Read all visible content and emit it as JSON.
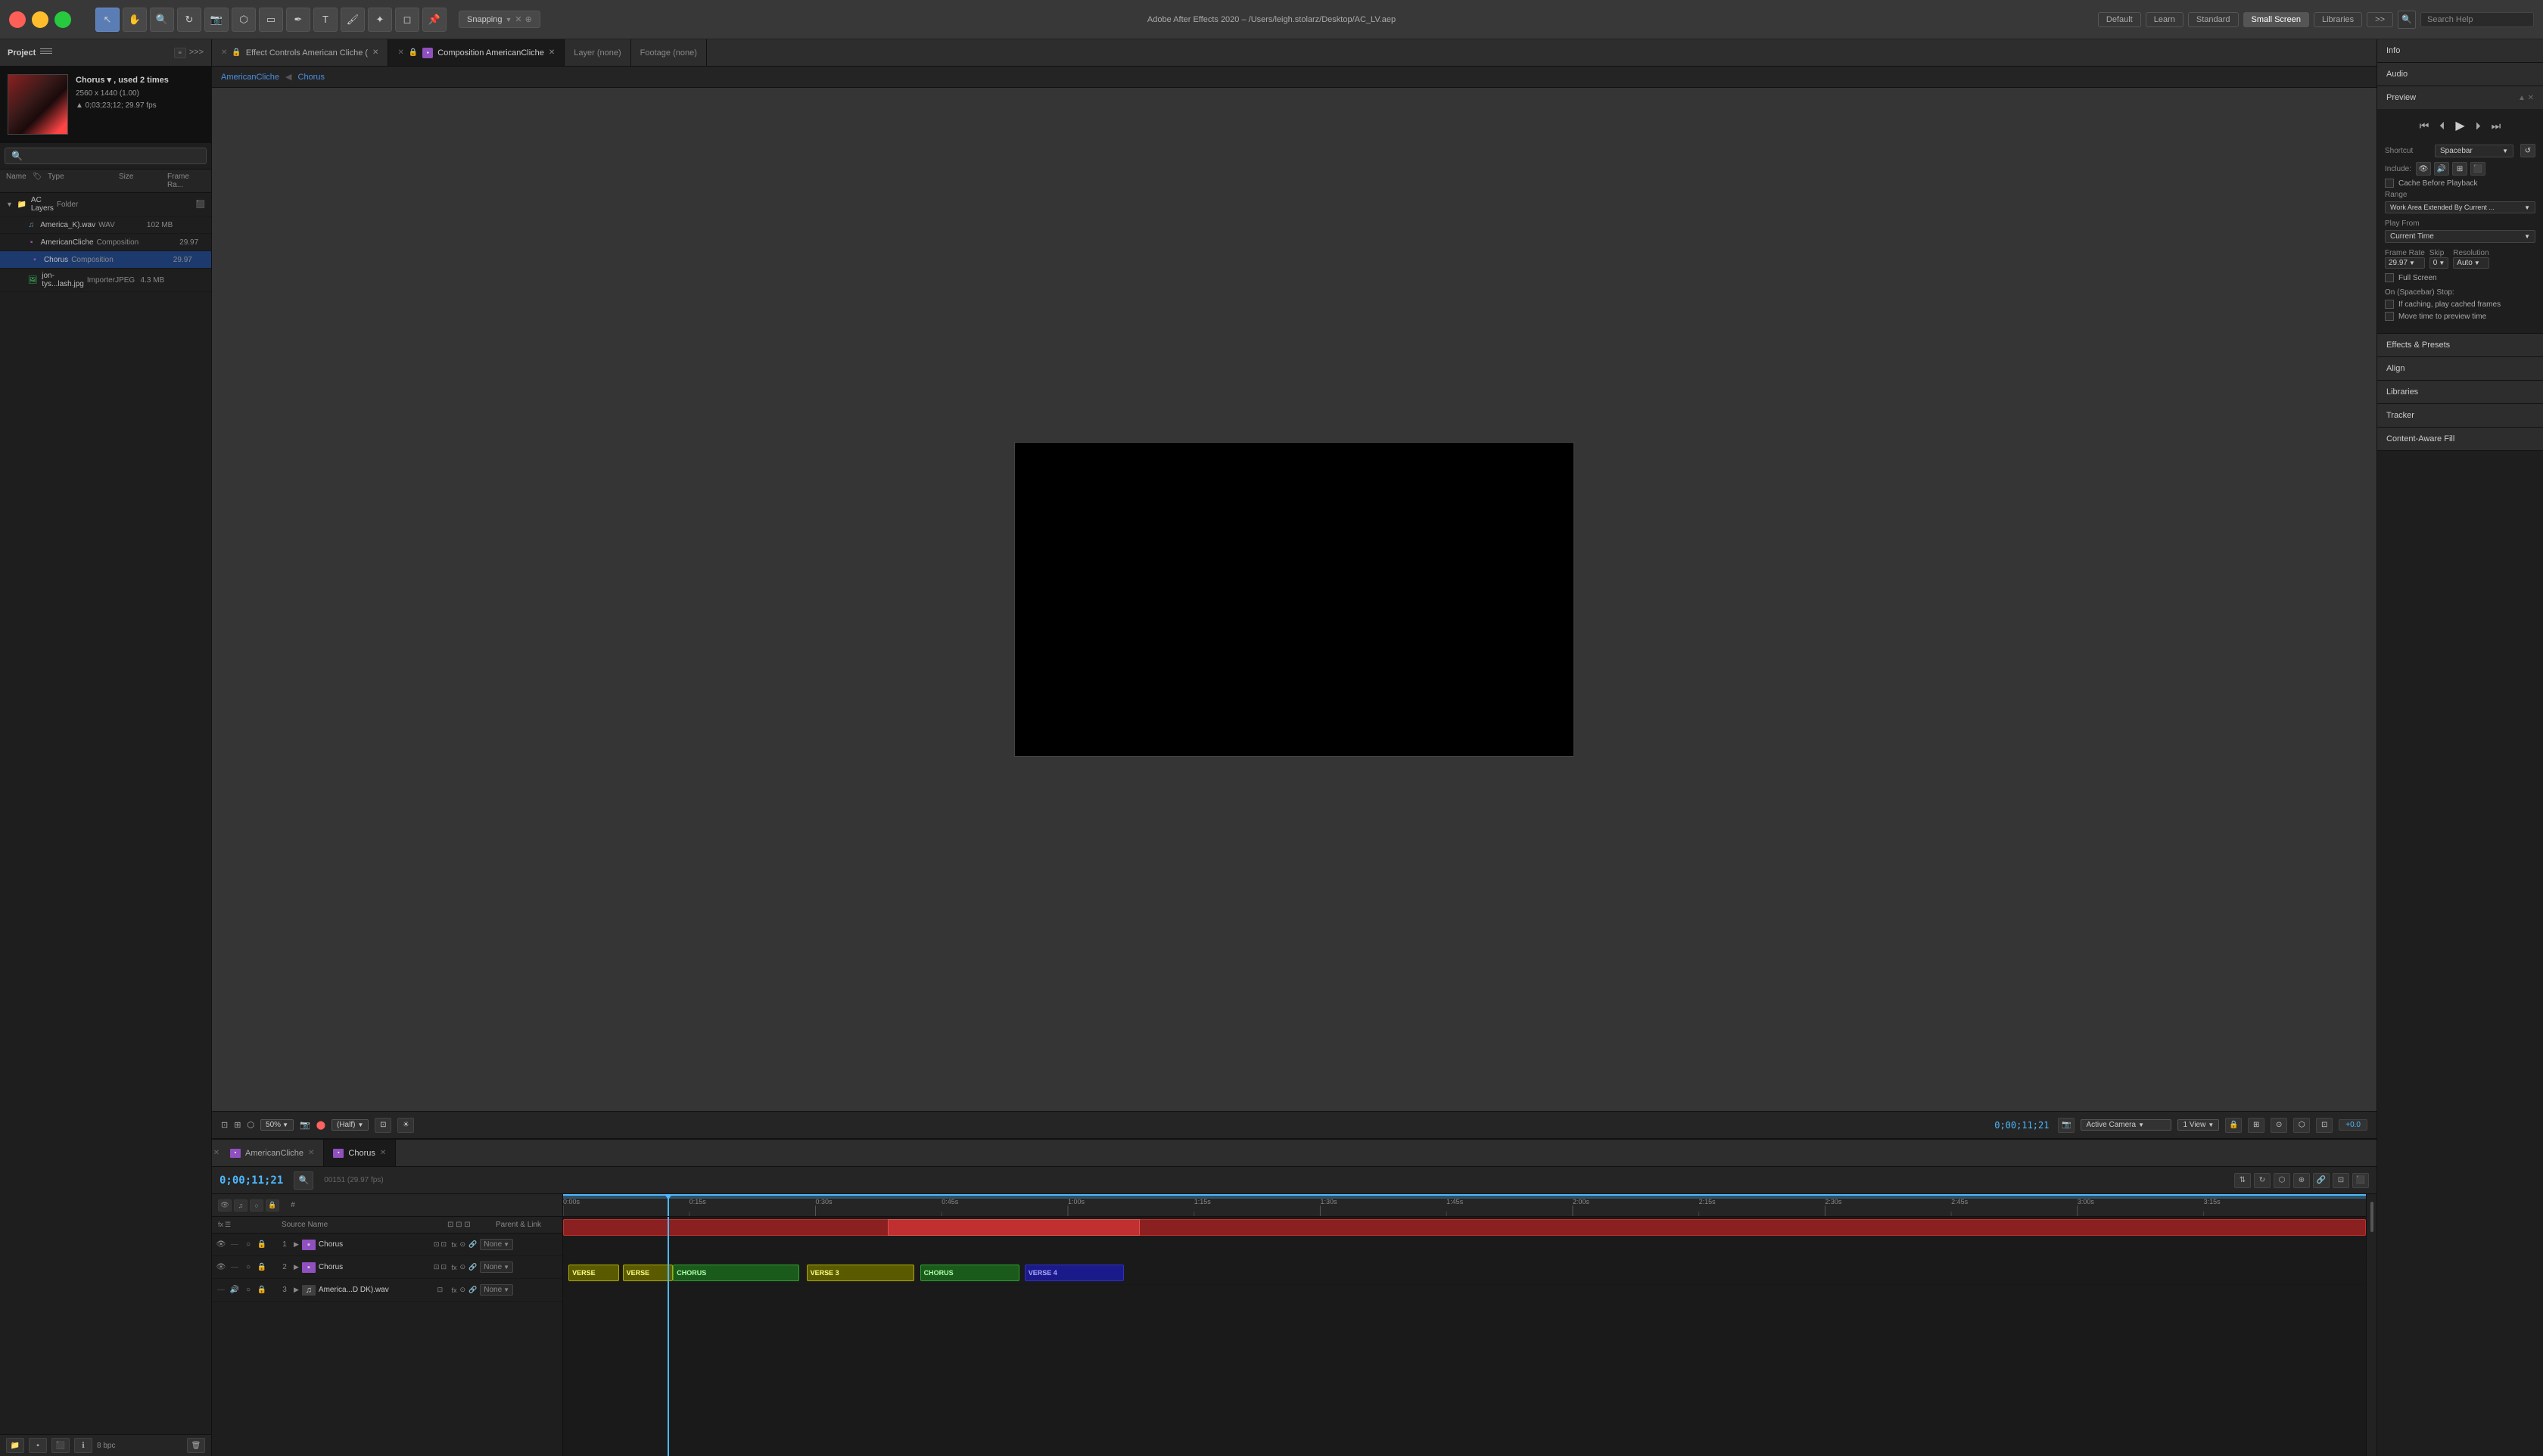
{
  "app": {
    "title": "Adobe After Effects 2020 – /Users/leigh.stolarz/Desktop/AC_LV.aep",
    "traffic_lights": [
      "close",
      "minimize",
      "maximize"
    ]
  },
  "menu_bar": {
    "tools": [
      "selection",
      "hand",
      "zoom",
      "rotate",
      "camera",
      "behind",
      "rectangle",
      "pen",
      "type",
      "brush",
      "clone",
      "eraser",
      "puppet"
    ],
    "snapping": "Snapping",
    "workspace_default": "Default",
    "workspace_learn": "Learn",
    "workspace_standard": "Standard",
    "workspace_small_screen": "Small Screen",
    "workspace_libraries": "Libraries",
    "more_icon": ">>",
    "search_placeholder": "Search Help"
  },
  "left_panel": {
    "header": "Project",
    "menu_icon": "☰",
    "preview": {
      "name": "Chorus ▾ , used 2 times",
      "resolution": "2560 x 1440 (1.00)",
      "timecode": "▲ 0;03;23;12; 29.97 fps"
    },
    "columns": {
      "name": "Name",
      "type": "Type",
      "size": "Size",
      "frame_rate": "Frame Ra..."
    },
    "files": [
      {
        "id": "ac-layers",
        "name": "AC Layers",
        "type": "Folder",
        "size": "",
        "frame_rate": "",
        "indent": 0,
        "icon": "folder",
        "expanded": true
      },
      {
        "id": "america-k-wav",
        "name": "America_K).wav",
        "type": "WAV",
        "size": "102 MB",
        "frame_rate": "",
        "indent": 1,
        "icon": "wav"
      },
      {
        "id": "american-cliche",
        "name": "AmericanCliche",
        "type": "Composition",
        "size": "",
        "frame_rate": "29.97",
        "indent": 1,
        "icon": "comp"
      },
      {
        "id": "chorus",
        "name": "Chorus",
        "type": "Composition",
        "size": "",
        "frame_rate": "29.97",
        "indent": 1,
        "icon": "comp",
        "selected": true
      },
      {
        "id": "jon-tys",
        "name": "jon-tys...lash.jpg",
        "type": "ImporterJPEG",
        "size": "4.3 MB",
        "frame_rate": "",
        "indent": 1,
        "icon": "img"
      }
    ],
    "bottom_bpc": "8 bpc"
  },
  "center_tabs": [
    {
      "id": "effect-controls",
      "label": "Effect Controls American Cliche (",
      "active": false,
      "closeable": true
    },
    {
      "id": "composition",
      "label": "Composition AmericanCliche",
      "active": true,
      "closeable": true
    }
  ],
  "layer_tabs": [
    {
      "id": "layer-none",
      "label": "Layer (none)"
    },
    {
      "id": "footage-none",
      "label": "Footage (none)"
    }
  ],
  "breadcrumb": [
    "AmericanCliche",
    "Chorus"
  ],
  "viewer": {
    "zoom": "50%",
    "timecode": "0;00;11;21",
    "resolution": "(Half)",
    "camera": "Active Camera",
    "view": "1 View",
    "offset": "+0.0"
  },
  "right_panel": {
    "sections": [
      {
        "id": "info",
        "label": "Info",
        "collapsed": true
      },
      {
        "id": "audio",
        "label": "Audio",
        "collapsed": true
      },
      {
        "id": "preview",
        "label": "Preview",
        "collapsed": false
      },
      {
        "id": "effects-presets",
        "label": "Effects & Presets",
        "collapsed": true
      },
      {
        "id": "align",
        "label": "Align",
        "collapsed": true
      },
      {
        "id": "libraries",
        "label": "Libraries",
        "collapsed": true
      },
      {
        "id": "tracker",
        "label": "Tracker",
        "collapsed": true
      },
      {
        "id": "content-aware-fill",
        "label": "Content-Aware Fill",
        "collapsed": true
      }
    ],
    "preview": {
      "shortcut_label": "Shortcut",
      "shortcut_value": "Spacebar",
      "include_label": "Include:",
      "eye_icon": "👁",
      "speaker_icon": "🔊",
      "cache_before_playback": "Cache Before Playback",
      "range_label": "Range",
      "range_value": "Work Area Extended By Current ...",
      "play_from_label": "Play From",
      "play_from_value": "Current Time",
      "frame_rate_label": "Frame Rate",
      "frame_rate_value": "29.97",
      "skip_label": "Skip",
      "skip_value": "0",
      "resolution_label": "Resolution",
      "resolution_value": "Auto",
      "full_screen": "Full Screen",
      "on_spacebar_stop": "On (Spacebar) Stop:",
      "if_caching": "If caching, play cached frames",
      "move_to_preview": "Move time to preview time"
    }
  },
  "timeline": {
    "tabs": [
      {
        "id": "americancliche",
        "label": "AmericanCliche",
        "active": false,
        "closeable": true
      },
      {
        "id": "chorus-tl",
        "label": "Chorus",
        "active": true,
        "closeable": true
      }
    ],
    "time": "0;00;11;21",
    "sub_time": "00151 (29.97 fps)",
    "layers": [
      {
        "id": 1,
        "name": "Chorus",
        "type": "comp",
        "num": "1",
        "parent": "None",
        "selected": false,
        "visible": true,
        "audio": false
      },
      {
        "id": 2,
        "name": "Chorus",
        "type": "comp",
        "num": "2",
        "parent": "None",
        "selected": false,
        "visible": true,
        "audio": false
      },
      {
        "id": 3,
        "name": "America...D DK).wav",
        "type": "wav",
        "num": "3",
        "parent": "None",
        "selected": false,
        "visible": false,
        "audio": true
      }
    ],
    "ruler_marks": [
      "0;00s",
      "0;15s",
      "0;30s",
      "0;45s",
      "1;00s",
      "1;15s",
      "1;30s",
      "1;45s",
      "2;00s",
      "2;15s",
      "2;30s",
      "2;45s",
      "3;00s",
      "3;15s"
    ],
    "clips": {
      "layer1": [
        {
          "label": "",
          "start_pct": 0,
          "width_pct": 100,
          "style": "red"
        }
      ],
      "layer2": [
        {
          "label": "VERSE",
          "start_pct": 0,
          "width_pct": 3.5,
          "style": "yellow"
        },
        {
          "label": "VERSE",
          "start_pct": 3.5,
          "width_pct": 3.5,
          "style": "yellow"
        },
        {
          "label": "CHORUS",
          "start_pct": 7,
          "width_pct": 7,
          "style": "green"
        },
        {
          "label": "VERSE 3",
          "start_pct": 14,
          "width_pct": 6,
          "style": "yellow"
        },
        {
          "label": "CHORUS",
          "start_pct": 20,
          "width_pct": 7,
          "style": "green"
        },
        {
          "label": "VERSE 4",
          "start_pct": 27,
          "width_pct": 7,
          "style": "blue"
        }
      ],
      "layer3": []
    },
    "playhead_pct": 5.8
  }
}
